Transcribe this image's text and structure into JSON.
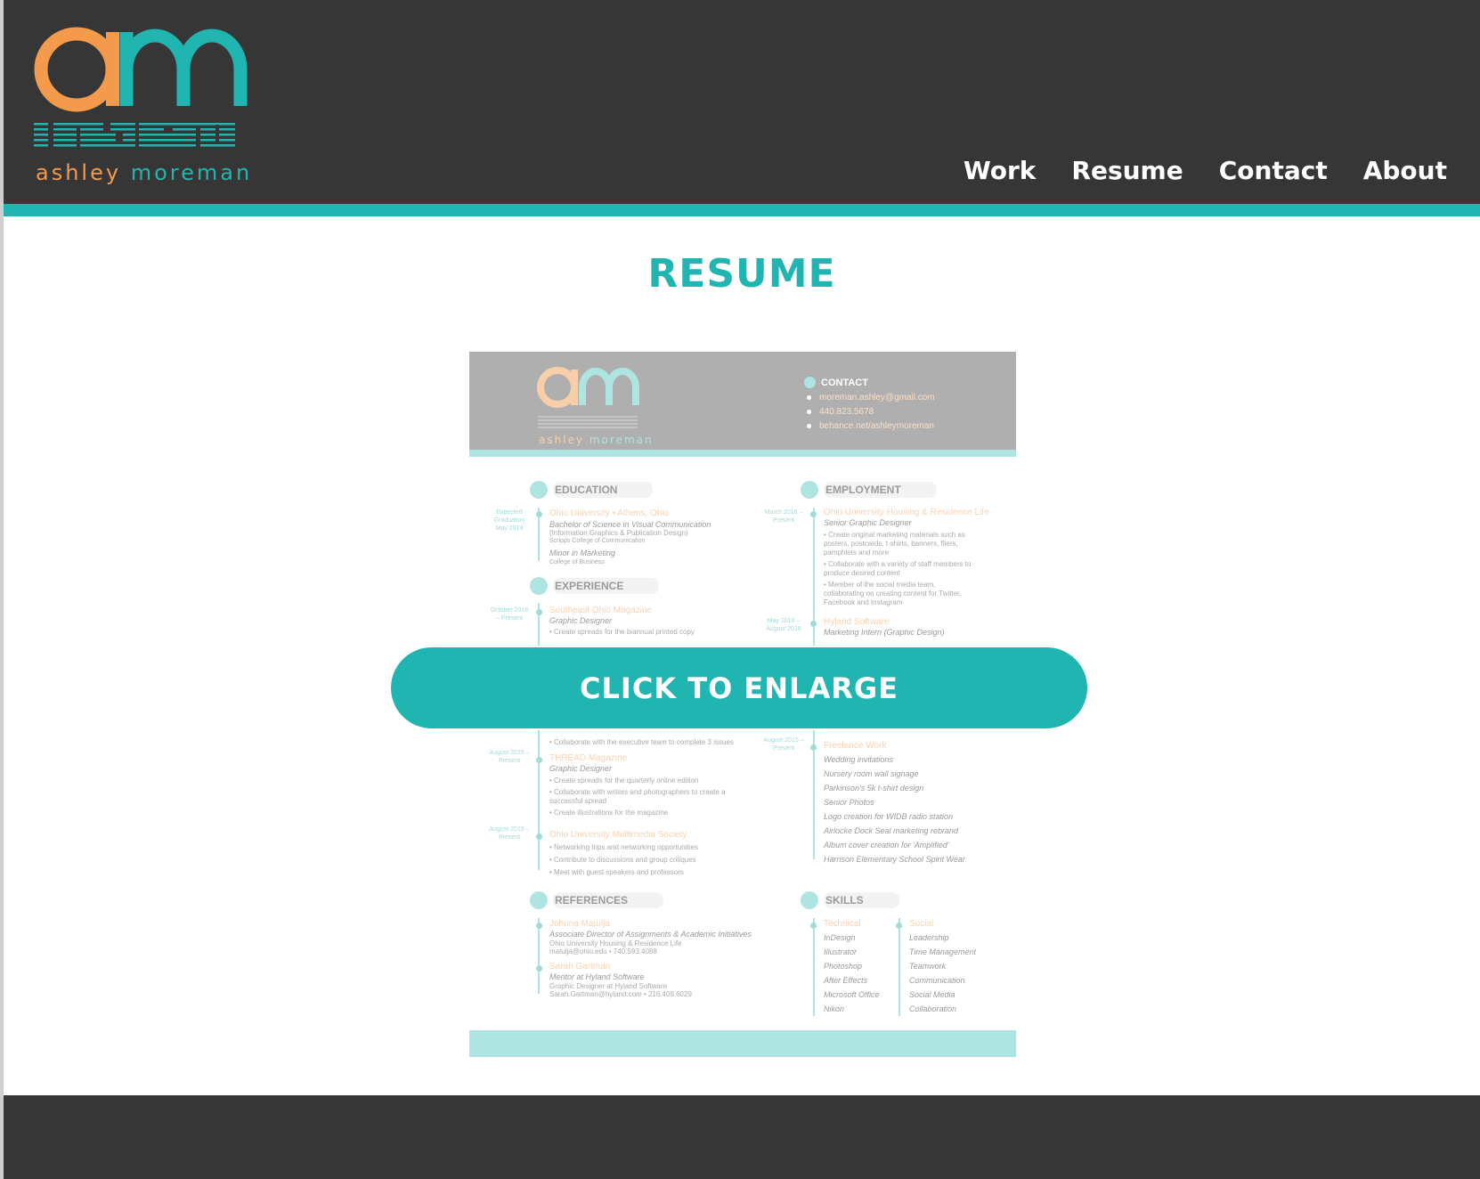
{
  "brand": {
    "first_name": "ashley",
    "last_name": "moreman",
    "orange": "#f49a4c",
    "teal": "#21b5b2",
    "dark": "#373636"
  },
  "nav": {
    "items": [
      {
        "label": "Work"
      },
      {
        "label": "Resume"
      },
      {
        "label": "Contact"
      },
      {
        "label": "About"
      }
    ]
  },
  "main": {
    "title": "RESUME",
    "enlarge_label": "CLICK TO ENLARGE"
  },
  "resume": {
    "first_name": "ashley",
    "last_name": "moreman",
    "contact": {
      "title": "CONTACT",
      "items": [
        "moreman.ashley@gmail.com",
        "440.823.5678",
        "behance.net/ashleymoreman"
      ]
    },
    "education": {
      "title": "EDUCATION",
      "date": "Expected Graduation May 2019",
      "school": "Ohio University • Athens, Ohio",
      "degree": "Bachelor of Science in Visual Communication",
      "focus": "(Information Graphics & Publication Design)",
      "college": "Scripps College of Communication",
      "minor": "Minor in Marketing",
      "minor_college": "College of Business"
    },
    "experience": {
      "title": "EXPERIENCE",
      "entries": [
        {
          "date": "October 2018 – Present",
          "org": "Southeast Ohio Magazine",
          "role": "Graphic Designer",
          "bullets": [
            "• Create spreads for the biannual printed copy",
            "• Collaborate with the executive team to complete 3 issues"
          ]
        },
        {
          "date": "August 2015 – Present",
          "org": "THREAD Magazine",
          "role": "Graphic Designer",
          "bullets": [
            "• Create spreads for the quarterly online edition",
            "• Collaborate with writers and photographers to create a",
            "  successful spread",
            "• Create illustrations for the magazine"
          ]
        },
        {
          "date": "August 2015 – Present",
          "org": "Ohio University Multimedia Society",
          "role": "",
          "bullets": [
            "• Networking trips and networking opportunities",
            "• Contribute to discussions and group critiques",
            "• Meet with guest speakers and professors"
          ]
        }
      ]
    },
    "employment": {
      "title": "EMPLOYMENT",
      "entries": [
        {
          "date": "March 2016 – Present",
          "org": "Ohio University Housing & Residence Life",
          "role": "Senior Graphic Designer",
          "bullets": [
            "• Create original marketing materials such as",
            "  posters, postcards, t-shirts, banners, fliers,",
            "  pamphlets and more",
            "• Collaborate with a variety of staff members to",
            "  produce desired content",
            "• Member of the social media team,",
            "  collaborating on creating content for Twitter,",
            "  Facebook and Instagram"
          ]
        },
        {
          "date": "May 2018 – August 2018",
          "org": "Hyland Software",
          "role": "Marketing Intern (Graphic Design)",
          "bullets": []
        },
        {
          "date": "August 2015 – Present",
          "org": "Freelance Work",
          "role": "",
          "bullets": [
            "Wedding invitations",
            "Nursery room wall signage",
            "Parkinson's 5k t-shirt design",
            "Senior Photos",
            "Logo creation for WIDB radio station",
            "Airlocke Dock Seal marketing rebrand",
            "Album cover creation for 'Amplified'",
            "Harrison Elementary School Spirit Wear"
          ]
        }
      ]
    },
    "references": {
      "title": "REFERENCES",
      "entries": [
        {
          "name": "Johnna Matulja",
          "role": "Associate Director of Assignments & Academic Initiatives",
          "org": "Ohio University Housing & Residence Life",
          "contact": "matulja@ohio.edu • 740.593.4088"
        },
        {
          "name": "Sarah Gartman",
          "role": "Mentor at Hyland Software",
          "org": "Graphic Designer at Hyland Software",
          "contact": "Sarah.Gartman@hyland.com • 216.409.6029"
        }
      ]
    },
    "skills": {
      "title": "SKILLS",
      "technical_title": "Technical",
      "technical": [
        "InDesign",
        "Illustrator",
        "Photoshop",
        "After Effects",
        "Microsoft Office",
        "Nikon"
      ],
      "social_title": "Social",
      "social": [
        "Leadership",
        "Time Management",
        "Teamwork",
        "Communication",
        "Social Media",
        "Collaboration"
      ]
    }
  }
}
